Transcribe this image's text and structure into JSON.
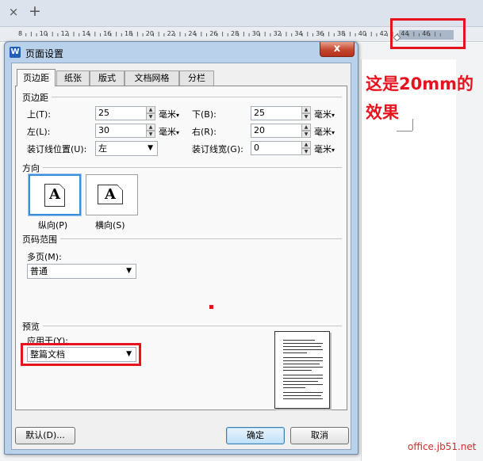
{
  "tabstrip": {
    "close_glyph": "×",
    "add_glyph": "+"
  },
  "ruler": {
    "labels": [
      "8",
      "10",
      "12",
      "14",
      "16",
      "18",
      "20",
      "22",
      "24",
      "26",
      "28",
      "30",
      "32",
      "34",
      "36",
      "38",
      "40",
      "42",
      "44",
      "46"
    ]
  },
  "annotation": {
    "line1": "这是20mm的",
    "line2": "效果",
    "color": "#e8121e"
  },
  "watermark": "office.jb51.net",
  "dialog": {
    "app_icon": "W",
    "title": "页面设置",
    "close_glyph": "x",
    "tabs": [
      "页边距",
      "纸张",
      "版式",
      "文档网格",
      "分栏"
    ],
    "active_tab": "页边距",
    "margins": {
      "section_title": "页边距",
      "top": {
        "label": "上(T):",
        "value": "25",
        "unit": "毫米"
      },
      "bottom": {
        "label": "下(B):",
        "value": "25",
        "unit": "毫米"
      },
      "left": {
        "label": "左(L):",
        "value": "30",
        "unit": "毫米"
      },
      "right": {
        "label": "右(R):",
        "value": "20",
        "unit": "毫米"
      },
      "gutter_position": {
        "label": "装订线位置(U):",
        "value": "左"
      },
      "gutter_width": {
        "label": "装订线宽(G):",
        "value": "0",
        "unit": "毫米"
      }
    },
    "orientation": {
      "section_title": "方向",
      "portrait": {
        "label": "纵向(P)",
        "glyph": "A"
      },
      "landscape": {
        "label": "横向(S)",
        "glyph": "A"
      },
      "selected": "portrait"
    },
    "page_range": {
      "section_title": "页码范围",
      "multiple_pages_label": "多页(M):",
      "multiple_pages_value": "普通"
    },
    "preview": {
      "section_title": "预览",
      "apply_to_label": "应用于(Y):",
      "apply_to_value": "整篇文档"
    },
    "buttons": {
      "default": "默认(D)...",
      "ok": "确定",
      "cancel": "取消"
    }
  },
  "colors": {
    "highlight": "#e8121e",
    "dialog_frame": "#b9d1ea",
    "selected_border": "#3b8fd9"
  }
}
